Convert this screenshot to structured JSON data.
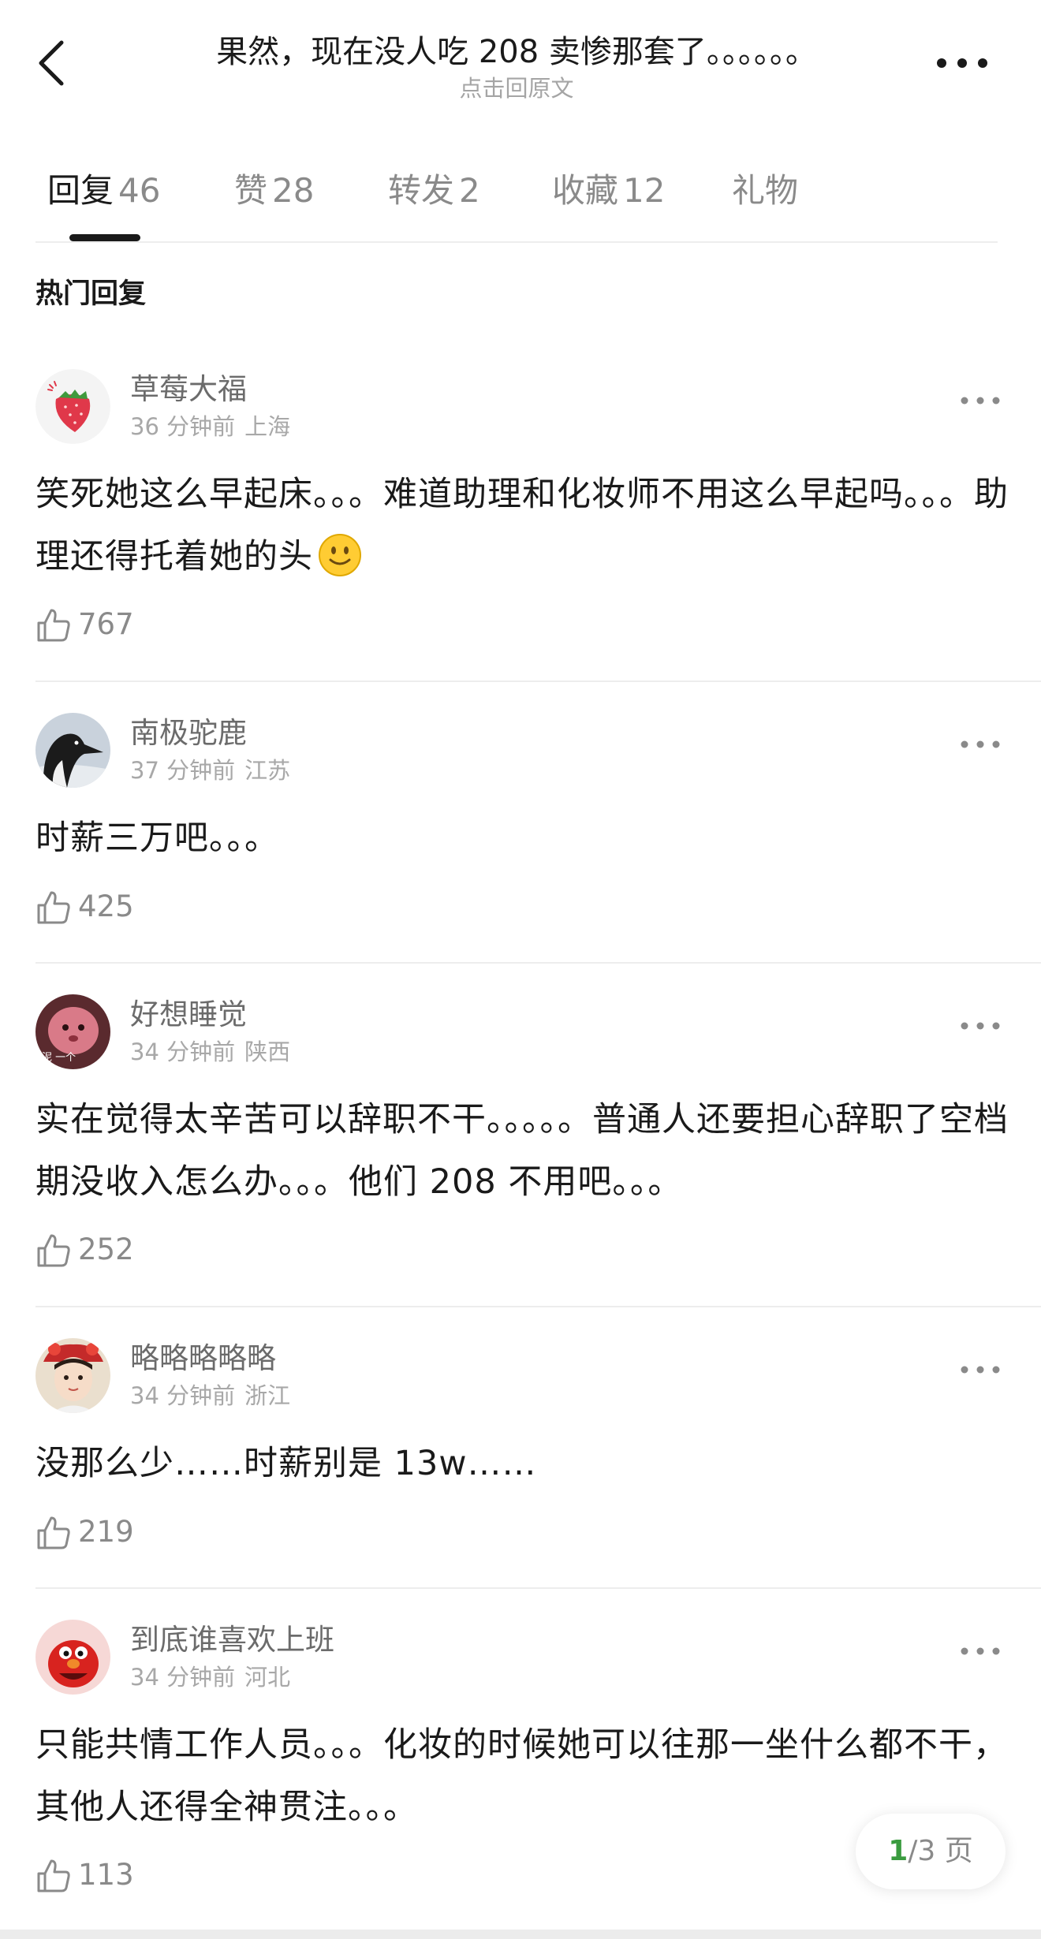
{
  "header": {
    "title": "果然，现在没人吃 208 卖惨那套了。。。。。。",
    "subtitle": "点击回原文",
    "back_icon": "chevron-left-icon",
    "more_icon": "more-horizontal-icon"
  },
  "tabs": [
    {
      "label": "回复",
      "count": "46",
      "active": true
    },
    {
      "label": "赞",
      "count": "28",
      "active": false
    },
    {
      "label": "转发",
      "count": "2",
      "active": false
    },
    {
      "label": "收藏",
      "count": "12",
      "active": false
    },
    {
      "label": "礼物",
      "count": "",
      "active": false
    }
  ],
  "section_title": "热门回复",
  "comments": [
    {
      "username": "草莓大福",
      "time": "36 分钟前",
      "location": "上海",
      "text": "笑死她这么早起床。。。难道助理和化妆师不用这么早起吗。。。助理还得托着她的头",
      "emoji": "slightly-smiling-face",
      "likes": "767",
      "avatar": "strawberry-avatar"
    },
    {
      "username": "南极驼鹿",
      "time": "37 分钟前",
      "location": "江苏",
      "text": "时薪三万吧。。。",
      "likes": "425",
      "avatar": "goose-avatar"
    },
    {
      "username": "好想睡觉",
      "time": "34 分钟前",
      "location": "陕西",
      "text": "实在觉得太辛苦可以辞职不干。。。。。普通人还要担心辞职了空档期没收入怎么办。。。他们 208 不用吧。。。",
      "likes": "252",
      "avatar": "pink-blob-avatar",
      "avatar_text": "泥 一个"
    },
    {
      "username": "略略略略略",
      "time": "34 分钟前",
      "location": "浙江",
      "text": "没那么少……时薪别是 13w……",
      "likes": "219",
      "avatar": "costume-girl-avatar"
    },
    {
      "username": "到底谁喜欢上班",
      "time": "34 分钟前",
      "location": "河北",
      "text": "只能共情工作人员。。。化妆的时候她可以往那一坐什么都不干，其他人还得全神贯注。。。",
      "likes": "113",
      "avatar": "red-monster-avatar"
    }
  ],
  "pager": {
    "current": "1",
    "total": "/3 页"
  },
  "colors": {
    "text": "#1a1a1a",
    "secondary": "#8a8a8a",
    "muted": "#a8a8a8",
    "divider": "#ededed",
    "pager_accent": "#3a9b3f"
  }
}
